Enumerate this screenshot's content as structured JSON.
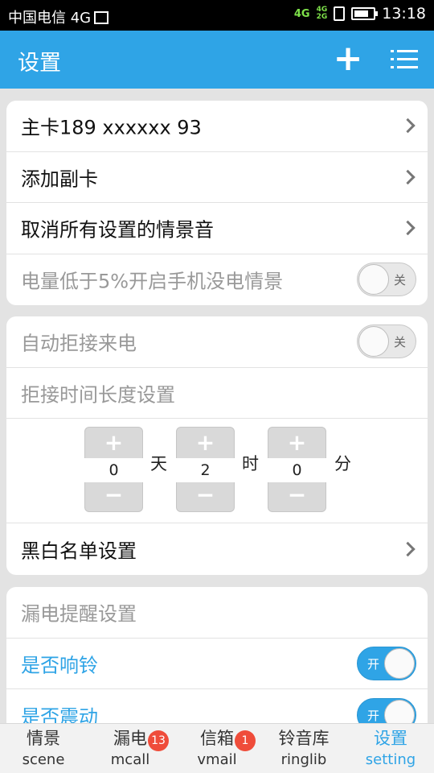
{
  "status_bar": {
    "carrier": "中国电信 4G",
    "network_top": "4G",
    "network_mini_top": "4G",
    "network_mini_bottom": "2G",
    "battery_level": 0.75,
    "time": "13:18"
  },
  "header": {
    "title": "设置",
    "add_icon": "plus-icon",
    "menu_icon": "list-menu-icon"
  },
  "section1": {
    "main_card": "主卡189 xxxxxx 93",
    "add_sub_card": "添加副卡",
    "cancel_all": "取消所有设置的情景音",
    "low_battery": "电量低于5%开启手机没电情景",
    "low_battery_toggle": "关"
  },
  "section2": {
    "auto_reject": "自动拒接来电",
    "auto_reject_toggle": "关",
    "reject_duration": "拒接时间长度设置",
    "picker_plus": "+",
    "picker_minus": "−",
    "days_value": "0",
    "days_unit": "天",
    "hours_value": "2",
    "hours_unit": "时",
    "minutes_value": "0",
    "minutes_unit": "分",
    "blacklist": "黑白名单设置"
  },
  "section3": {
    "header": "漏电提醒设置",
    "ring": "是否响铃",
    "ring_toggle": "开",
    "vibrate": "是否震动",
    "vibrate_toggle": "开"
  },
  "tabs": [
    {
      "cn": "情景",
      "en": "scene"
    },
    {
      "cn": "漏电",
      "en": "mcall",
      "badge": "13"
    },
    {
      "cn": "信箱",
      "en": "vmail",
      "badge": "1"
    },
    {
      "cn": "铃音库",
      "en": "ringlib"
    },
    {
      "cn": "设置",
      "en": "setting"
    }
  ],
  "colors": {
    "accent": "#2fa4e6",
    "badge": "#ef4c3a",
    "net": "#7ee14a"
  }
}
